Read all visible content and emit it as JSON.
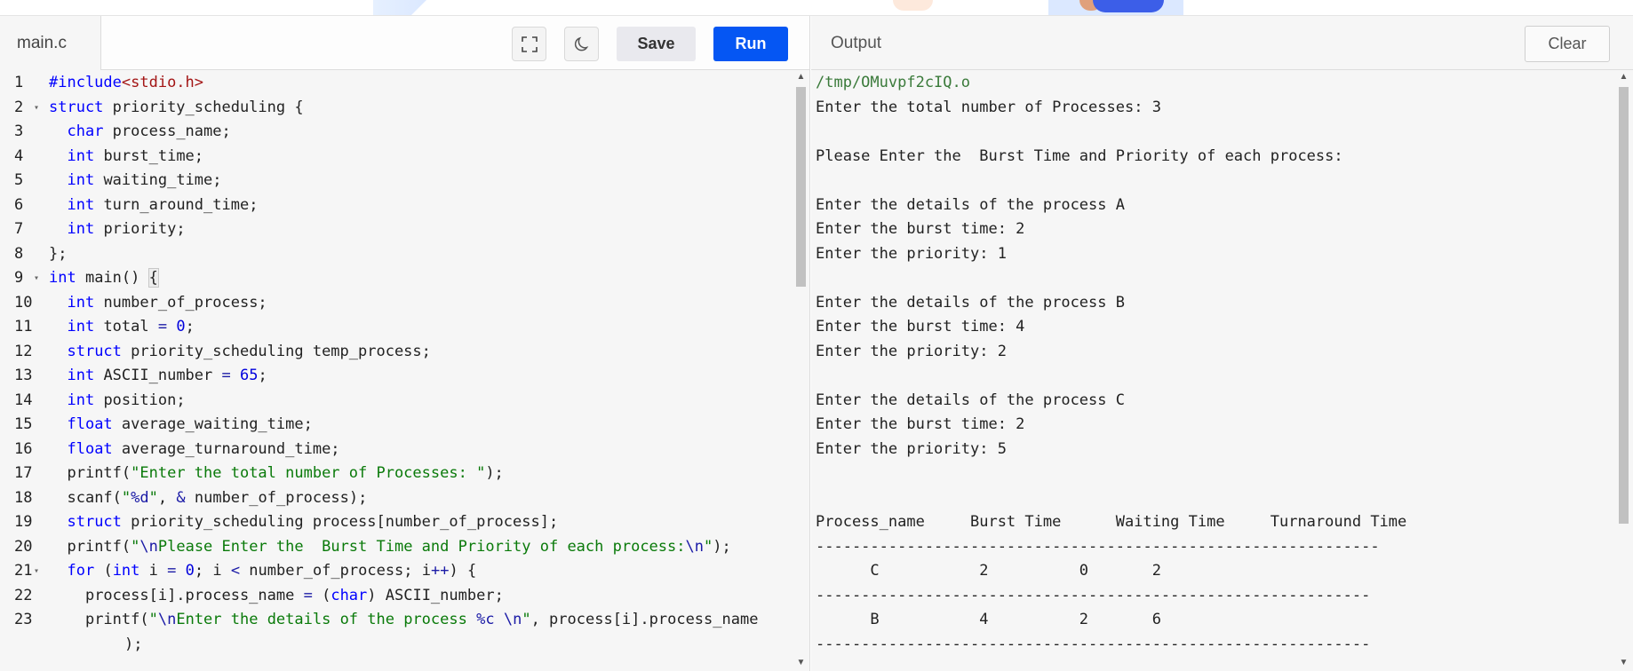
{
  "editor": {
    "file_tab": "main.c",
    "save_label": "Save",
    "run_label": "Run",
    "line_numbers": [
      "1",
      "2",
      "3",
      "4",
      "5",
      "6",
      "7",
      "8",
      "9",
      "10",
      "11",
      "12",
      "13",
      "14",
      "15",
      "16",
      "17",
      "18",
      "19",
      "20",
      "21",
      "22",
      "23"
    ]
  },
  "code": {
    "l1_kw": "#include",
    "l1_hdr": "<stdio.h>",
    "l2_kw": "struct",
    "l2_rest": " priority_scheduling {",
    "l3_kw": "char",
    "l3_rest": " process_name;",
    "l4_kw": "int",
    "l4_rest": " burst_time;",
    "l5_kw": "int",
    "l5_rest": " waiting_time;",
    "l6_kw": "int",
    "l6_rest": " turn_around_time;",
    "l7_kw": "int",
    "l7_rest": " priority;",
    "l8": "};",
    "l9_kw": "int",
    "l9_rest": " main() ",
    "l9_brace": "{",
    "l10_kw": "int",
    "l10_rest": " number_of_process;",
    "l11_kw": "int",
    "l11_rest": " total ",
    "l11_eq": "=",
    "l11_num": "0",
    "l11_end": ";",
    "l12_kw": "struct",
    "l12_rest": " priority_scheduling temp_process;",
    "l13_kw": "int",
    "l13_rest": " ASCII_number ",
    "l13_eq": "=",
    "l13_num": "65",
    "l13_end": ";",
    "l14_kw": "int",
    "l14_rest": " position;",
    "l15_kw": "float",
    "l15_rest": " average_waiting_time;",
    "l16_kw": "float",
    "l16_rest": " average_turnaround_time;",
    "l17_fn": "printf(",
    "l17_str": "\"Enter the total number of Processes: \"",
    "l17_end": ");",
    "l18_fn": "scanf(",
    "l18_q1": "\"",
    "l18_fmt": "%d",
    "l18_q2": "\"",
    "l18_mid": ", ",
    "l18_amp": "&",
    "l18_end": " number_of_process);",
    "l19_kw": "struct",
    "l19_rest": " priority_scheduling process[number_of_process];",
    "l20_fn": "printf(",
    "l20_q1": "\"",
    "l20_esc1": "\\n",
    "l20_str": "Please Enter the  Burst Time and Priority of each process:",
    "l20_esc2": "\\n",
    "l20_q2": "\"",
    "l20_end": ");",
    "l21_kw": "for",
    "l21_a": " (",
    "l21_kw2": "int",
    "l21_b": " i ",
    "l21_eq": "=",
    "l21_num": " 0",
    "l21_c": "; i ",
    "l21_lt": "<",
    "l21_d": " number_of_process; i",
    "l21_pp": "++",
    "l21_e": ") {",
    "l22_a": "process[i].process_name ",
    "l22_eq": "=",
    "l22_b": " (",
    "l22_kw": "char",
    "l22_c": ") ASCII_number;",
    "l23_fn": "printf(",
    "l23_q1": "\"",
    "l23_esc1": "\\n",
    "l23_str": "Enter the details of the process ",
    "l23_fmt": "%c",
    "l23_sp": " ",
    "l23_esc2": "\\n",
    "l23_q2": "\"",
    "l23_end": ", process[i].process_name",
    "l23_wrap": ");"
  },
  "output": {
    "title": "Output",
    "clear_label": "Clear",
    "lines": [
      "/tmp/OMuvpf2cIQ.o",
      "Enter the total number of Processes: 3",
      "",
      "Please Enter the  Burst Time and Priority of each process:",
      "",
      "Enter the details of the process A",
      "Enter the burst time: 2",
      "Enter the priority: 1",
      "",
      "Enter the details of the process B",
      "Enter the burst time: 4",
      "Enter the priority: 2",
      "",
      "Enter the details of the process C",
      "Enter the burst time: 2",
      "Enter the priority: 5",
      "",
      "",
      "Process_name     Burst Time      Waiting Time     Turnaround Time",
      "--------------------------------------------------------------",
      "      C           2          0       2",
      "-------------------------------------------------------------",
      "      B           4          2       6",
      "-------------------------------------------------------------"
    ]
  }
}
